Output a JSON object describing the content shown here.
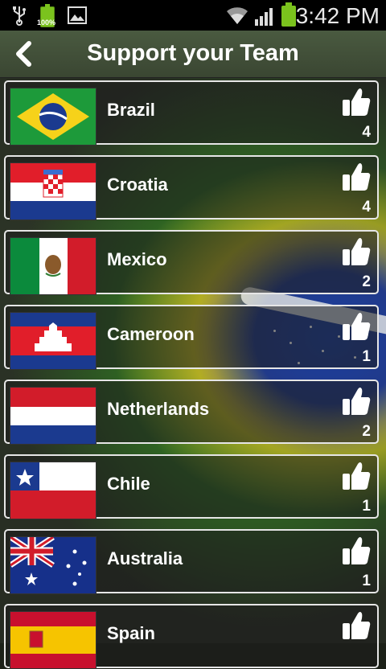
{
  "status_bar": {
    "time": "3:42 PM",
    "battery_percent_label": "100%",
    "icons": [
      "usb-icon",
      "battery-icon",
      "image-icon",
      "wifi-icon",
      "signal-icon",
      "battery-icon"
    ]
  },
  "header": {
    "title": "Support your Team",
    "back_icon": "back-chevron-icon"
  },
  "teams": [
    {
      "name": "Brazil",
      "likes": "4",
      "flag": "brazil-flag"
    },
    {
      "name": "Croatia",
      "likes": "4",
      "flag": "croatia-flag"
    },
    {
      "name": "Mexico",
      "likes": "2",
      "flag": "mexico-flag"
    },
    {
      "name": "Cameroon",
      "likes": "1",
      "flag": "cambodia-flag"
    },
    {
      "name": "Netherlands",
      "likes": "2",
      "flag": "netherlands-flag"
    },
    {
      "name": "Chile",
      "likes": "1",
      "flag": "chile-flag"
    },
    {
      "name": "Australia",
      "likes": "1",
      "flag": "australia-flag"
    },
    {
      "name": "Spain",
      "likes": "",
      "flag": "spain-flag"
    }
  ],
  "colors": {
    "header": "#3f4c36",
    "status_bar": "#000000",
    "item_border": "#e6e6e6"
  }
}
